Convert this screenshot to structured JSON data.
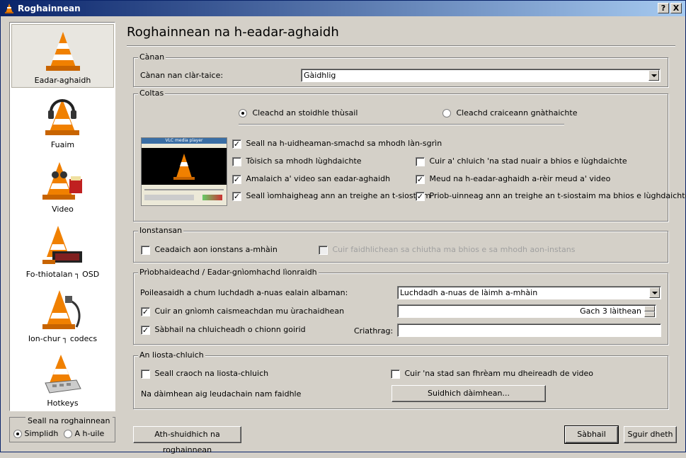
{
  "window": {
    "title": "Roghainnean",
    "help_btn": "?",
    "close_btn": "X"
  },
  "sidebar": {
    "items": [
      {
        "label": "Eadar-aghaidh",
        "icon": "vlc-cone-icon"
      },
      {
        "label": "Fuaim",
        "icon": "headphones-cone-icon"
      },
      {
        "label": "Video",
        "icon": "glasses-cone-icon"
      },
      {
        "label": "Fo-thiotalan ┐ OSD",
        "icon": "clock-cone-icon"
      },
      {
        "label": "Ion-chur ┐ codecs",
        "icon": "cable-cone-icon"
      },
      {
        "label": "Hotkeys",
        "icon": "keyboard-cone-icon"
      }
    ]
  },
  "show_settings": {
    "title": "Seall na roghainnean",
    "simple": "Simplidh",
    "all": "A h-uile"
  },
  "panel": {
    "title": "Roghainnean na h-eadar-aghaidh"
  },
  "language": {
    "title": "Cànan",
    "label": "Cànan nan clàr-taice:",
    "value": "Gàidhlig"
  },
  "look": {
    "title": "Coltas",
    "native_style": "Cleachd an stoidhle thùsail",
    "custom_skin": "Cleachd craiceann gnàthaichte",
    "fullscreen_controls": "Seall na h-uidheaman-smachd sa mhodh làn-sgrìn",
    "start_minimized": "Tòisich sa mhodh lùghdaichte",
    "pause_minimized": "Cuir a' chluich 'na stad nuair a bhios e lùghdaichte",
    "embed_video": "Amalaich a' video san eadar-aghaidh",
    "resize_interface": "Meud na h-eadar-aghaidh a-rèir meud a' video",
    "systray_icon": "Seall ìomhaigheag ann an treighe an t-siostaim",
    "systray_popup": "Priob-uinneag ann an treighe an t-siostaim ma bhios e lùghdaichte",
    "preview_title": "VLC media player"
  },
  "instances": {
    "title": "Ionstansan",
    "single_instance": "Ceadaich aon ionstans a-mhàin",
    "enqueue": "Cuir faidhlichean sa chiutha ma bhios e sa mhodh aon-instans"
  },
  "privacy": {
    "title": "Prìobhaideachd / Eadar-gnìomhachd lìonraidh",
    "art_policy_label": "Poileasaidh a chum luchdadh a-nuas ealain albaman:",
    "art_policy_value": "Luchdadh a-nuas de làimh a-mhàin",
    "update_check": "Cuir an gnìomh caismeachdan mu ùrachaidhean",
    "update_interval": "Gach 3 làithean",
    "save_recent": "Sàbhail na chluicheadh o chionn goirid",
    "filter_label": "Criathrag:",
    "filter_value": ""
  },
  "playlist": {
    "title": "An liosta-chluich",
    "show_tree": "Seall craoch na liosta-chluich",
    "pause_end": "Cuir 'na stad san fhrèam mu dheireadh de video",
    "assoc_label": "Na dàimhean aig leudachain nam faidhle",
    "assoc_button": "Suidhich dàimhean..."
  },
  "footer": {
    "reset": "Ath-shuidhich na roghainnean",
    "save": "Sàbhail",
    "cancel": "Sguir dheth"
  },
  "check_mark": "✓"
}
